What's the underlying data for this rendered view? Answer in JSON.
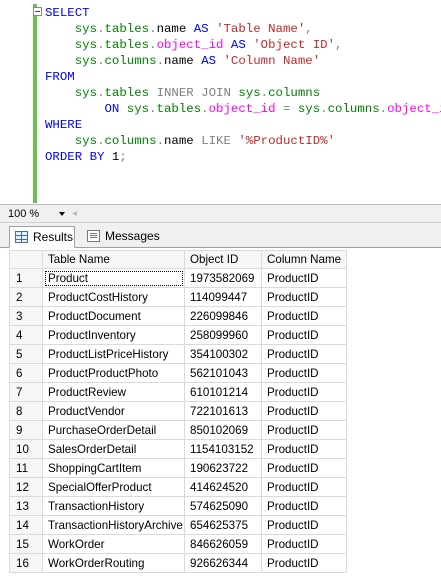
{
  "editor": {
    "lines": [
      [
        {
          "t": "SELECT",
          "c": "kw"
        }
      ],
      [
        {
          "t": "    sys",
          "c": "sys"
        },
        {
          "t": ".",
          "c": "gry"
        },
        {
          "t": "tables",
          "c": "sys"
        },
        {
          "t": ".",
          "c": "gry"
        },
        {
          "t": "name ",
          "c": ""
        },
        {
          "t": "AS ",
          "c": "kw"
        },
        {
          "t": "'Table Name'",
          "c": "str"
        },
        {
          "t": ",",
          "c": "gry"
        }
      ],
      [
        {
          "t": "    sys",
          "c": "sys"
        },
        {
          "t": ".",
          "c": "gry"
        },
        {
          "t": "tables",
          "c": "sys"
        },
        {
          "t": ".",
          "c": "gry"
        },
        {
          "t": "object_id ",
          "c": "fn"
        },
        {
          "t": "AS ",
          "c": "kw"
        },
        {
          "t": "'Object ID'",
          "c": "str"
        },
        {
          "t": ",",
          "c": "gry"
        }
      ],
      [
        {
          "t": "    sys",
          "c": "sys"
        },
        {
          "t": ".",
          "c": "gry"
        },
        {
          "t": "columns",
          "c": "sys"
        },
        {
          "t": ".",
          "c": "gry"
        },
        {
          "t": "name ",
          "c": ""
        },
        {
          "t": "AS ",
          "c": "kw"
        },
        {
          "t": "'Column Name'",
          "c": "str"
        }
      ],
      [
        {
          "t": "FROM",
          "c": "kw"
        }
      ],
      [
        {
          "t": "    sys",
          "c": "sys"
        },
        {
          "t": ".",
          "c": "gry"
        },
        {
          "t": "tables ",
          "c": "sys"
        },
        {
          "t": "INNER JOIN ",
          "c": "gry"
        },
        {
          "t": "sys",
          "c": "sys"
        },
        {
          "t": ".",
          "c": "gry"
        },
        {
          "t": "columns",
          "c": "sys"
        }
      ],
      [
        {
          "t": "        ON ",
          "c": "kw"
        },
        {
          "t": "sys",
          "c": "sys"
        },
        {
          "t": ".",
          "c": "gry"
        },
        {
          "t": "tables",
          "c": "sys"
        },
        {
          "t": ".",
          "c": "gry"
        },
        {
          "t": "object_id ",
          "c": "fn"
        },
        {
          "t": "= ",
          "c": "gry"
        },
        {
          "t": "sys",
          "c": "sys"
        },
        {
          "t": ".",
          "c": "gry"
        },
        {
          "t": "columns",
          "c": "sys"
        },
        {
          "t": ".",
          "c": "gry"
        },
        {
          "t": "object_id",
          "c": "fn"
        }
      ],
      [
        {
          "t": "WHERE",
          "c": "kw"
        }
      ],
      [
        {
          "t": "    sys",
          "c": "sys"
        },
        {
          "t": ".",
          "c": "gry"
        },
        {
          "t": "columns",
          "c": "sys"
        },
        {
          "t": ".",
          "c": "gry"
        },
        {
          "t": "name ",
          "c": ""
        },
        {
          "t": "LIKE ",
          "c": "gry"
        },
        {
          "t": "'%ProductID%'",
          "c": "str"
        }
      ],
      [
        {
          "t": "ORDER BY ",
          "c": "kw"
        },
        {
          "t": "1",
          "c": ""
        },
        {
          "t": ";",
          "c": "gry"
        }
      ]
    ]
  },
  "zoom": {
    "value": "100 %"
  },
  "tabs": {
    "results": "Results",
    "messages": "Messages"
  },
  "grid": {
    "columns": [
      "Table Name",
      "Object ID",
      "Column Name"
    ],
    "rows": [
      [
        "1",
        "Product",
        "1973582069",
        "ProductID"
      ],
      [
        "2",
        "ProductCostHistory",
        "114099447",
        "ProductID"
      ],
      [
        "3",
        "ProductDocument",
        "226099846",
        "ProductID"
      ],
      [
        "4",
        "ProductInventory",
        "258099960",
        "ProductID"
      ],
      [
        "5",
        "ProductListPriceHistory",
        "354100302",
        "ProductID"
      ],
      [
        "6",
        "ProductProductPhoto",
        "562101043",
        "ProductID"
      ],
      [
        "7",
        "ProductReview",
        "610101214",
        "ProductID"
      ],
      [
        "8",
        "ProductVendor",
        "722101613",
        "ProductID"
      ],
      [
        "9",
        "PurchaseOrderDetail",
        "850102069",
        "ProductID"
      ],
      [
        "10",
        "SalesOrderDetail",
        "1154103152",
        "ProductID"
      ],
      [
        "11",
        "ShoppingCartItem",
        "190623722",
        "ProductID"
      ],
      [
        "12",
        "SpecialOfferProduct",
        "414624520",
        "ProductID"
      ],
      [
        "13",
        "TransactionHistory",
        "574625090",
        "ProductID"
      ],
      [
        "14",
        "TransactionHistoryArchive",
        "654625375",
        "ProductID"
      ],
      [
        "15",
        "WorkOrder",
        "846626059",
        "ProductID"
      ],
      [
        "16",
        "WorkOrderRouting",
        "926626344",
        "ProductID"
      ]
    ]
  }
}
